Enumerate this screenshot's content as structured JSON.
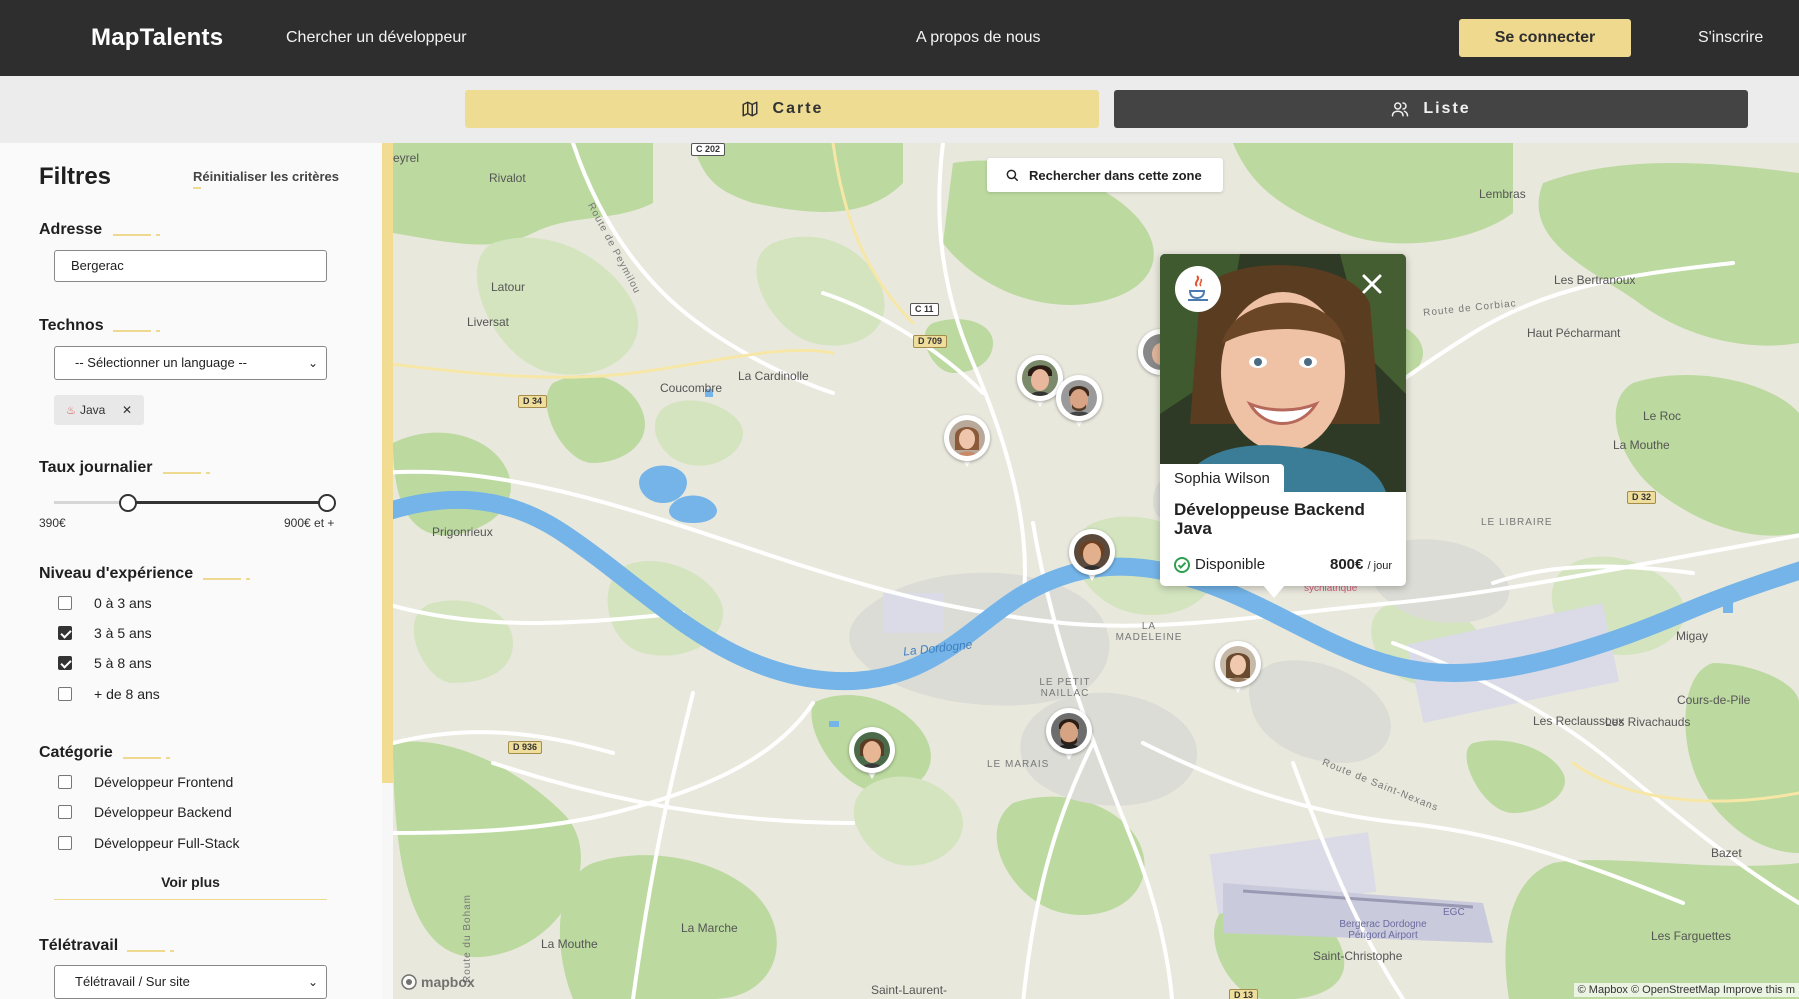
{
  "header": {
    "brand": "MapTalents",
    "nav_search": "Chercher un développeur",
    "nav_about": "A propos de nous",
    "login": "Se connecter",
    "signup": "S'inscrire"
  },
  "view_toggle": {
    "map_label": "Carte",
    "list_label": "Liste",
    "active": "map"
  },
  "filters": {
    "title": "Filtres",
    "reset": "Réinitialiser les critères",
    "address": {
      "label": "Adresse",
      "value": "Bergerac"
    },
    "technos": {
      "label": "Technos",
      "select_value": "-- Sélectionner un language --",
      "chips": [
        {
          "label": "Java"
        }
      ]
    },
    "rate": {
      "label": "Taux journalier",
      "min_label": "390€",
      "max_label": "900€ et +",
      "min_fraction": 0.26,
      "max_fraction": 1.0
    },
    "experience": {
      "label": "Niveau d'expérience",
      "options": [
        {
          "label": "0 à 3 ans",
          "checked": false
        },
        {
          "label": "3 à 5 ans",
          "checked": true
        },
        {
          "label": "5 à 8 ans",
          "checked": true
        },
        {
          "label": "+ de 8 ans",
          "checked": false
        }
      ]
    },
    "category": {
      "label": "Catégorie",
      "options": [
        {
          "label": "Développeur Frontend",
          "checked": false
        },
        {
          "label": "Développeur Backend",
          "checked": false
        },
        {
          "label": "Développeur Full-Stack",
          "checked": false
        }
      ],
      "more": "Voir plus"
    },
    "remote": {
      "label": "Télétravail",
      "select_value": "Télétravail / Sur site"
    }
  },
  "map": {
    "search_zone": "Rechercher dans cette zone",
    "place_labels": [
      "eyrel",
      "Rivalot",
      "Latour",
      "Liversat",
      "Coucombre",
      "La Cardinolle",
      "Prigonrieux",
      "Lembras",
      "Les Bertranoux",
      "Haut Pécharmant",
      "Le Roc",
      "La Mouthe",
      "Migay",
      "Les Reclaussoux",
      "Les Rivachauds",
      "Cours-de-Pile",
      "Bazet",
      "Les Farguettes",
      "Saint-Christophe",
      "La Marche",
      "La Mouthe",
      "Saint-Laurent-",
      "Route de Peymilou",
      "Route de Corbiac",
      "Route de Saint-Nexans",
      "Route du Boham",
      "La Dordogne",
      "LA MADELEINE",
      "LE PETIT NAILLAC",
      "LE MARAIS",
      "LE LIBRAIRE",
      "Bergerac Dordogne Périgord Airport",
      "EGC",
      "sychiatrique"
    ],
    "road_badges": [
      "C 202",
      "C 11",
      "D 709",
      "D 34",
      "D 936",
      "D 32",
      "D 13"
    ],
    "mapbox_logo": "mapbox",
    "attribution": "© Mapbox © OpenStreetMap Improve this m"
  },
  "popup": {
    "name": "Sophia Wilson",
    "title": "Développeuse Backend Java",
    "status": "Disponible",
    "price": "800€",
    "price_unit": "/ jour",
    "tech_icon": "java-icon",
    "status_color": "#2e9e4f"
  },
  "colors": {
    "accent": "#efd98f",
    "header_bg": "#2e2e2e",
    "river": "#74b4e8",
    "forest": "#bcd9a0"
  }
}
